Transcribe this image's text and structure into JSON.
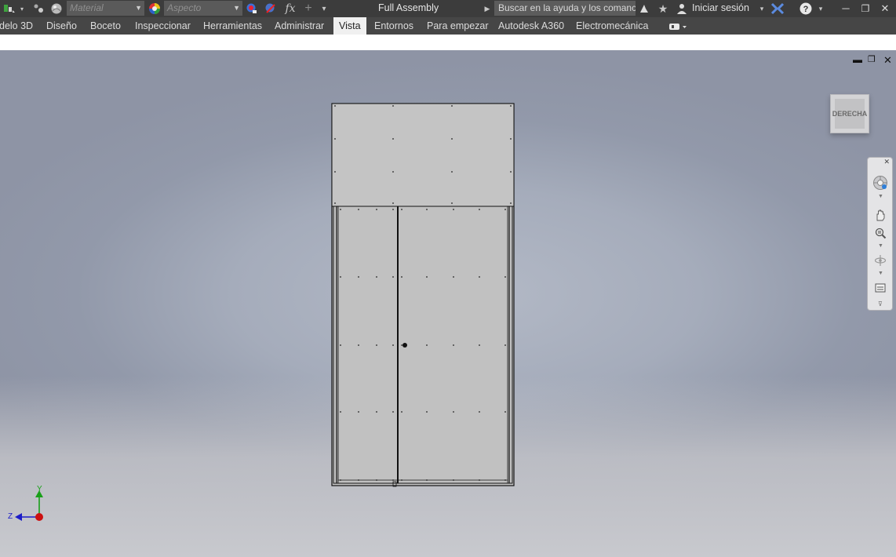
{
  "window": {
    "title": "Full Assembly"
  },
  "quick_access": {
    "material_placeholder": "Material",
    "appearance_placeholder": "Aspecto",
    "fx_label": "fx"
  },
  "search": {
    "placeholder": "Buscar en la ayuda y los comanc"
  },
  "account": {
    "sign_in_label": "Iniciar sesión"
  },
  "ribbon": {
    "tabs": [
      {
        "label": "delo 3D"
      },
      {
        "label": "Diseño"
      },
      {
        "label": "Boceto"
      },
      {
        "label": "Inspeccionar"
      },
      {
        "label": "Herramientas"
      },
      {
        "label": "Administrar"
      },
      {
        "label": "Vista",
        "active": true
      },
      {
        "label": "Entornos"
      },
      {
        "label": "Para empezar"
      },
      {
        "label": "Autodesk A360"
      },
      {
        "label": "Electromecánica"
      }
    ]
  },
  "viewcube": {
    "face_label": "DERECHA"
  },
  "triad": {
    "y_label": "Y",
    "z_label": "Z"
  },
  "icons": {
    "app_menu": "app-menu-icon",
    "appearance": "color-wheel-icon",
    "help": "help-icon",
    "steering_wheel": "steering-wheel-icon",
    "pan": "pan-icon",
    "zoom": "zoom-icon",
    "orbit": "orbit-icon",
    "look_at": "look-at-icon"
  },
  "colors": {
    "titlebar": "#3c3c3c",
    "ribbon": "#464646",
    "active_tab": "#f0f0f0",
    "part_face": "#c3c3c3",
    "axis_y": "#19a019",
    "axis_z": "#1c1cc8",
    "origin": "#cc1010"
  }
}
